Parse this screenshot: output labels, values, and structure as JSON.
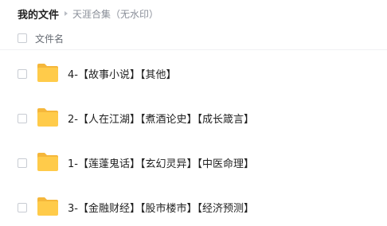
{
  "breadcrumb": {
    "root": "我的文件",
    "current": "天涯合集（无水印）"
  },
  "list_header": {
    "column_name": "文件名"
  },
  "files": [
    {
      "name": "4-【故事小说】【其他】",
      "type": "folder"
    },
    {
      "name": "2-【人在江湖】【煮酒论史】【成长箴言】",
      "type": "folder"
    },
    {
      "name": "1-【莲蓬鬼话】【玄幻灵异】【中医命理】",
      "type": "folder"
    },
    {
      "name": "3-【金融财经】【股市楼市】【经济预测】",
      "type": "folder"
    }
  ],
  "icons": {
    "folder": "folder-icon",
    "breadcrumb_separator": "caret-right-icon"
  },
  "colors": {
    "folder_front": "#FFCB4A",
    "folder_back": "#F5B73B",
    "checkbox_border": "#C8CCD3",
    "muted_text": "#8A8F99"
  }
}
